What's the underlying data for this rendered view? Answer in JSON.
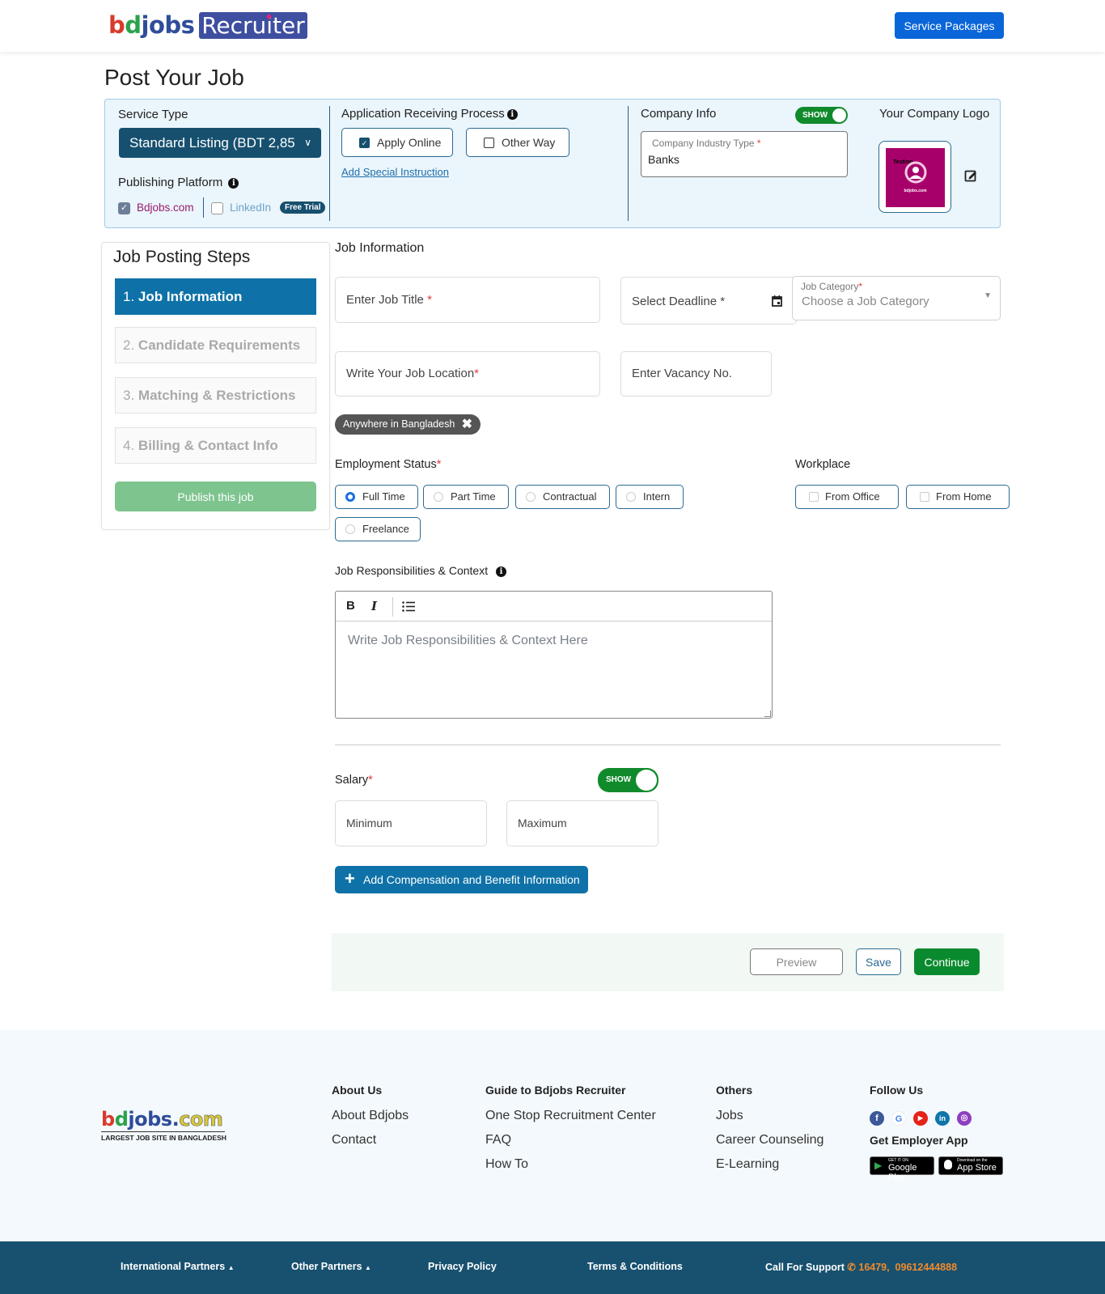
{
  "header": {
    "logo_bdjobs": [
      "b",
      "d",
      "jobs"
    ],
    "logo_recruiter": "Recruiter",
    "service_packages": "Service Packages"
  },
  "page_title": "Post Your Job",
  "top_panel": {
    "service_type_label": "Service Type",
    "service_type_value": "Standard Listing (BDT 2,85",
    "publishing_platform_label": "Publishing Platform",
    "platforms": [
      {
        "label": "Bdjobs.com",
        "checked": true
      },
      {
        "label": "LinkedIn",
        "checked": false
      }
    ],
    "free_trial_badge": "Free Trial",
    "application_process_label": "Application Receiving Process",
    "apply_online": {
      "label": "Apply Online",
      "checked": true
    },
    "other_way": {
      "label": "Other Way",
      "checked": false
    },
    "add_special_instruction": "Add Special Instruction",
    "company_info_label": "Company Info",
    "company_info_toggle": "SHOW",
    "industry_type_label": "Company Industry Type",
    "industry_type_value": "Banks",
    "company_logo_label": "Your Company Logo",
    "logo_image_text": "Testing",
    "logo_image_caption": "bdjobs.com"
  },
  "steps": {
    "heading": "Job Posting Steps",
    "items": [
      {
        "num": "1.",
        "label": "Job Information",
        "active": true
      },
      {
        "num": "2.",
        "label": "Candidate Requirements",
        "active": false
      },
      {
        "num": "3.",
        "label": "Matching & Restrictions",
        "active": false
      },
      {
        "num": "4.",
        "label": "Billing & Contact Info",
        "active": false
      }
    ],
    "publish": "Publish this job"
  },
  "job_info": {
    "heading": "Job Information",
    "job_title_placeholder": "Enter Job Title",
    "deadline_placeholder": "Select Deadline *",
    "category_label": "Job Category",
    "category_placeholder": "Choose a Job Category",
    "location_placeholder": "Write Your Job Location",
    "vacancy_placeholder": "Enter Vacancy No.",
    "location_chip": "Anywhere in Bangladesh",
    "employment_status_label": "Employment Status",
    "employment_options": [
      {
        "label": "Full Time",
        "selected": true
      },
      {
        "label": "Part Time",
        "selected": false
      },
      {
        "label": "Contractual",
        "selected": false
      },
      {
        "label": "Intern",
        "selected": false
      },
      {
        "label": "Freelance",
        "selected": false
      }
    ],
    "workplace_label": "Workplace",
    "workplace_options": [
      {
        "label": "From Office",
        "checked": false
      },
      {
        "label": "From Home",
        "checked": false
      }
    ],
    "responsibilities_label": "Job Responsibilities & Context",
    "responsibilities_placeholder": "Write Job Responsibilities & Context Here",
    "editor_tools": [
      "B",
      "I",
      "list"
    ],
    "salary_label": "Salary",
    "salary_toggle": "SHOW",
    "salary_min_placeholder": "Minimum",
    "salary_max_placeholder": "Maximum",
    "add_compensation": "Add Compensation and Benefit Information"
  },
  "actions": {
    "preview": "Preview",
    "save": "Save",
    "continue": "Continue"
  },
  "footer": {
    "logo_tagline": "LARGEST JOB SITE IN BANGLADESH",
    "columns": [
      {
        "title": "About Us",
        "links": [
          "About Bdjobs",
          "Contact"
        ]
      },
      {
        "title": "Guide to Bdjobs Recruiter",
        "links": [
          "One Stop Recruitment Center",
          "FAQ",
          "How To"
        ]
      },
      {
        "title": "Others",
        "links": [
          "Jobs",
          "Career Counseling",
          "E-Learning"
        ]
      }
    ],
    "follow_us": "Follow Us",
    "social": [
      "facebook",
      "google",
      "youtube",
      "linkedin",
      "instagram"
    ],
    "get_app": "Get Employer App",
    "google_play": {
      "small": "GET IT ON",
      "big": "Google Play"
    },
    "app_store": {
      "small": "Download on the",
      "big": "App Store"
    }
  },
  "bottom_bar": {
    "international_partners": "International Partners",
    "other_partners": "Other Partners",
    "privacy_policy": "Privacy Policy",
    "terms": "Terms & Conditions",
    "call_support": "Call For Support",
    "phone": "16479,  09612444888"
  },
  "colors": {
    "primary_dark": "#17506f",
    "active_step": "#0e72a8",
    "continue_green": "#0a8a2e",
    "service_packages_blue": "#0a66d8",
    "footer_bar": "#18516f",
    "support_phone": "#f08a2c"
  }
}
